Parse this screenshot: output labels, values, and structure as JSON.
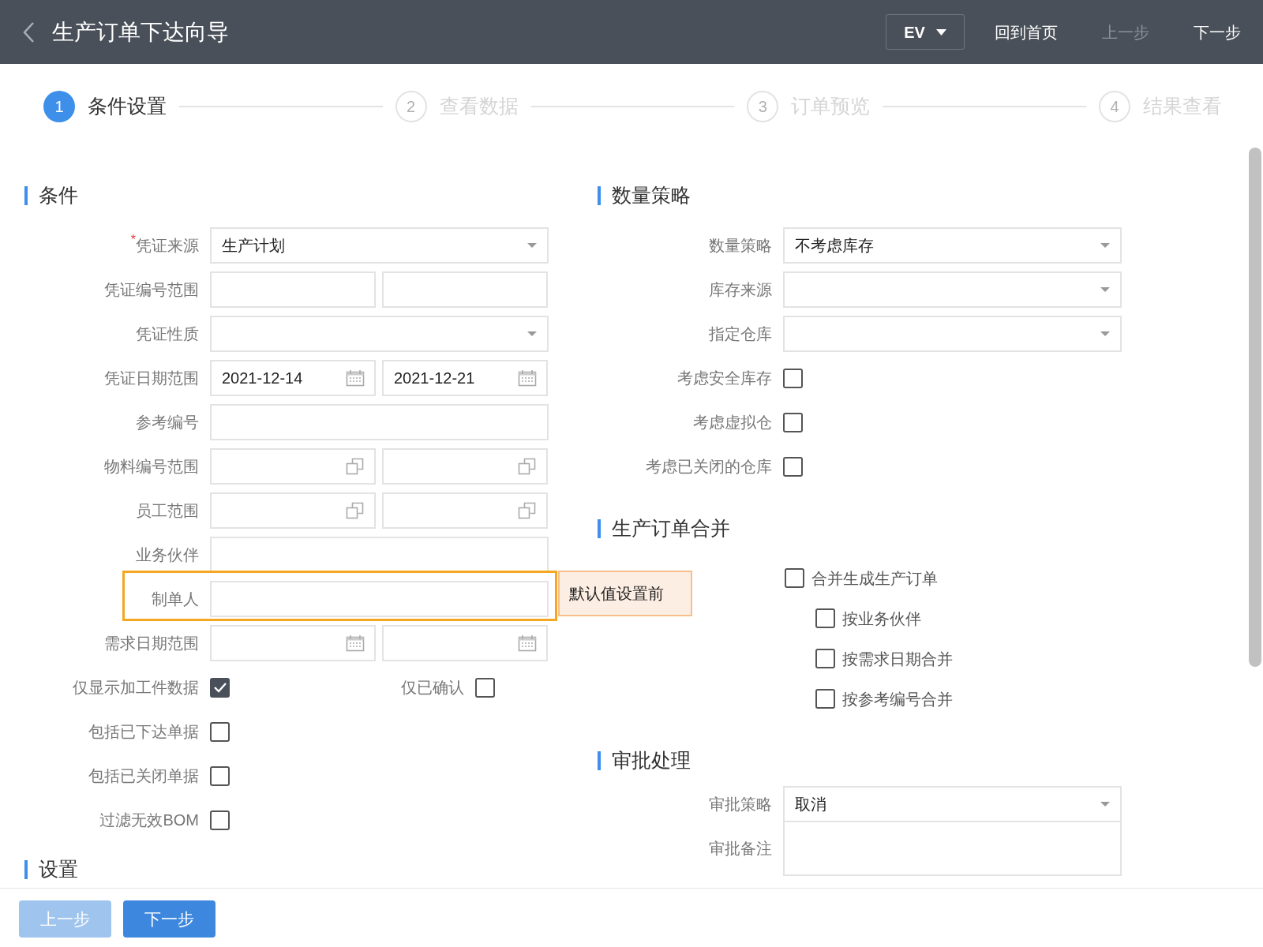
{
  "header": {
    "title": "生产订单下达向导",
    "language": "EV",
    "actions": [
      {
        "label": "回到首页",
        "disabled": false
      },
      {
        "label": "上一步",
        "disabled": true
      },
      {
        "label": "下一步",
        "disabled": false
      }
    ]
  },
  "steps": [
    {
      "number": "1",
      "label": "条件设置",
      "selected": true
    },
    {
      "number": "2",
      "label": "查看数据",
      "selected": false
    },
    {
      "number": "3",
      "label": "订单预览",
      "selected": false
    },
    {
      "number": "4",
      "label": "结果查看",
      "selected": false
    }
  ],
  "conditions": {
    "title": "条件",
    "fields": [
      {
        "kind": "select",
        "label": "凭证来源",
        "required_mark": "*",
        "value": "生产计划"
      },
      {
        "kind": "range",
        "label": "凭证编号范围"
      },
      {
        "kind": "select",
        "label": "凭证性质"
      },
      {
        "kind": "date_range",
        "label": "凭证日期范围",
        "from": "2021-12-14",
        "to": "2021-12-21"
      },
      {
        "kind": "input",
        "label": "参考编号"
      },
      {
        "kind": "lookup_range",
        "label": "物料编号范围"
      },
      {
        "kind": "lookup_range",
        "label": "员工范围"
      },
      {
        "kind": "input",
        "label": "业务伙伴"
      },
      {
        "kind": "input",
        "label": "制单人",
        "highlighted": true,
        "note": "默认值设置前"
      },
      {
        "kind": "date_range",
        "label": "需求日期范围"
      },
      {
        "kind": "checkbox_pair",
        "label": "仅显示加工件数据",
        "checked": true,
        "second_label": "仅已确认",
        "second_checked": false
      },
      {
        "kind": "checkbox",
        "label": "包括已下达单据",
        "checked": false
      },
      {
        "kind": "checkbox",
        "label": "包括已关闭单据",
        "checked": false
      },
      {
        "kind": "checkbox",
        "label": "过滤无效BOM",
        "checked": false
      }
    ]
  },
  "settings": {
    "title": "设置"
  },
  "quantity_strategy": {
    "title": "数量策略",
    "fields": [
      {
        "kind": "select",
        "label": "数量策略",
        "value": "不考虑库存"
      },
      {
        "kind": "select",
        "label": "库存来源"
      },
      {
        "kind": "select",
        "label": "指定仓库"
      },
      {
        "kind": "checkbox",
        "label": "考虑安全库存",
        "checked": false
      },
      {
        "kind": "checkbox",
        "label": "考虑虚拟仓",
        "checked": false
      },
      {
        "kind": "checkbox",
        "label": "考虑已关闭的仓库",
        "checked": false
      }
    ]
  },
  "order_merge": {
    "title": "生产订单合并",
    "options": [
      {
        "label": "合并生成生产订单",
        "checked": false,
        "children": [
          {
            "label": "按业务伙伴",
            "checked": false
          },
          {
            "label": "按需求日期合并",
            "checked": false
          },
          {
            "label": "按参考编号合并",
            "checked": false
          }
        ]
      }
    ]
  },
  "approval": {
    "title": "审批处理",
    "fields": [
      {
        "kind": "select",
        "label": "审批策略",
        "value": "取消"
      },
      {
        "kind": "textarea",
        "label": "审批备注"
      }
    ]
  },
  "footer": {
    "buttons": [
      {
        "label": "上一步",
        "disabled": true
      },
      {
        "label": "下一步",
        "disabled": false
      }
    ]
  }
}
